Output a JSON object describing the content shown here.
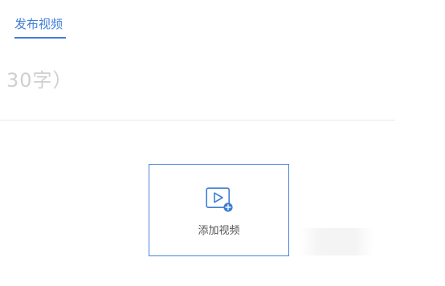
{
  "tabs": {
    "active_label": "发布视频"
  },
  "title_field": {
    "placeholder_fragment": "30字）"
  },
  "upload": {
    "label": "添加视频",
    "icon": "video-add-icon"
  },
  "colors": {
    "accent": "#3f7ed6",
    "placeholder": "#cfcfcf",
    "divider": "#e9e9e9",
    "upload_border": "#4a84d6"
  }
}
